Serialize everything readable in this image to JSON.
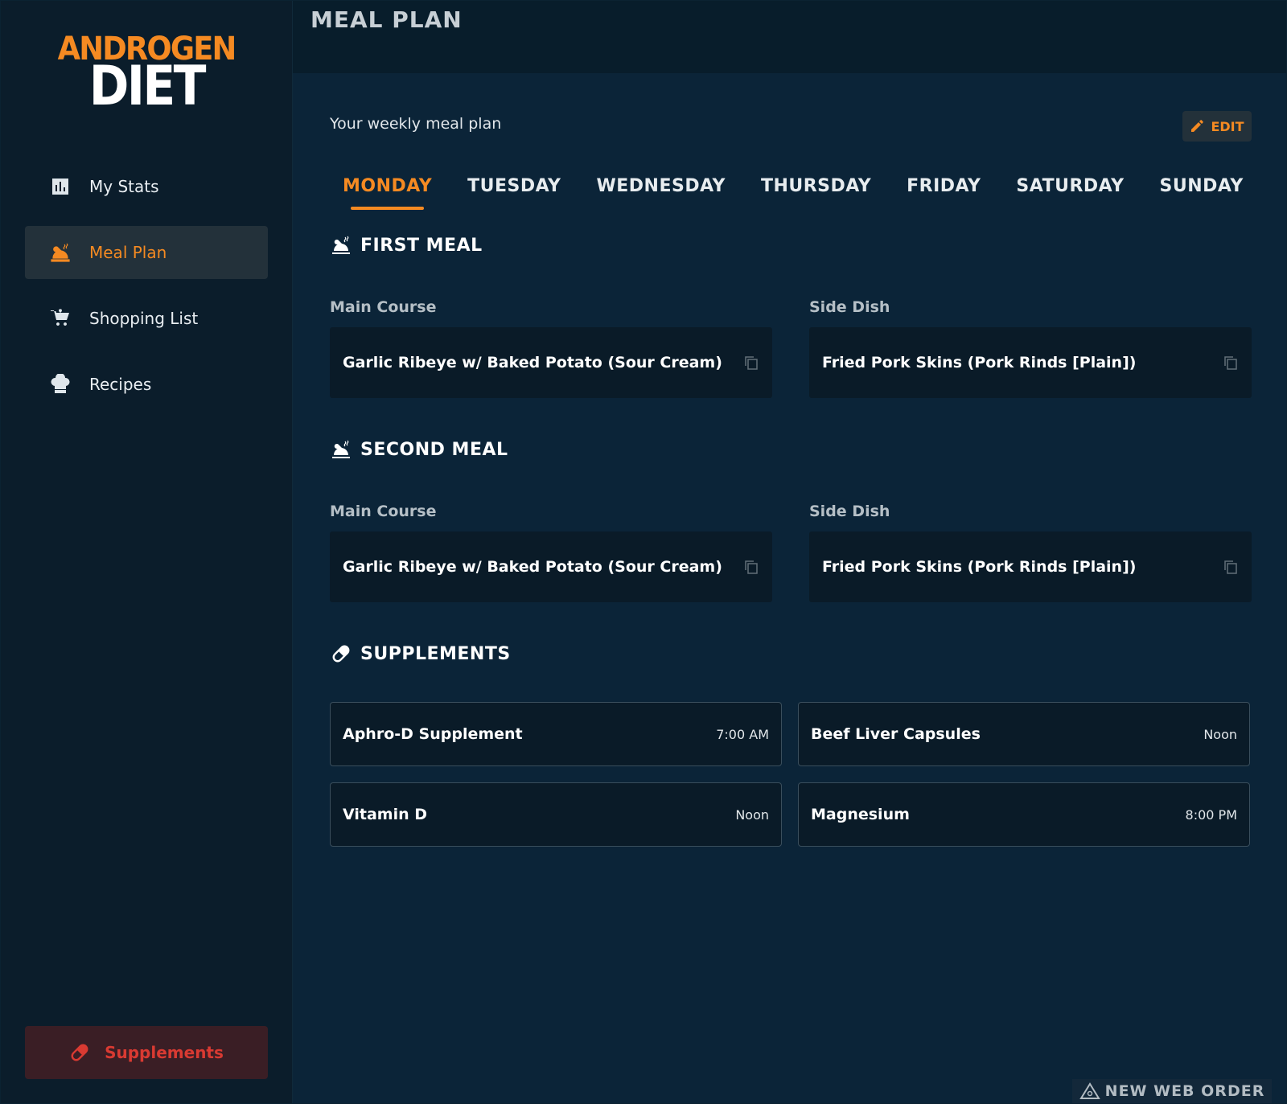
{
  "brand": {
    "line1": "ANDROGEN",
    "line2": "DIET",
    "accent_color": "#f58a22"
  },
  "sidebar": {
    "items": [
      {
        "label": "My Stats",
        "icon": "chart-icon"
      },
      {
        "label": "Meal Plan",
        "icon": "turkey-icon",
        "active": true
      },
      {
        "label": "Shopping List",
        "icon": "cart-icon"
      },
      {
        "label": "Recipes",
        "icon": "chef-hat-icon"
      }
    ],
    "supplements_button": "Supplements"
  },
  "header": {
    "title": "MEAL PLAN"
  },
  "plan": {
    "subtitle": "Your weekly meal plan",
    "edit_label": "EDIT",
    "days": [
      "MONDAY",
      "TUESDAY",
      "WEDNESDAY",
      "THURSDAY",
      "FRIDAY",
      "SATURDAY",
      "SUNDAY"
    ],
    "active_day": "MONDAY"
  },
  "meals": [
    {
      "title": "FIRST MEAL",
      "main_label": "Main Course",
      "main": "Garlic Ribeye w/ Baked Potato (Sour Cream)",
      "side_label": "Side Dish",
      "side": "Fried Pork Skins (Pork Rinds [Plain])"
    },
    {
      "title": "SECOND MEAL",
      "main_label": "Main Course",
      "main": "Garlic Ribeye w/ Baked Potato (Sour Cream)",
      "side_label": "Side Dish",
      "side": "Fried Pork Skins (Pork Rinds [Plain])"
    }
  ],
  "supplements": {
    "title": "SUPPLEMENTS",
    "items": [
      {
        "name": "Aphro-D Supplement",
        "time": "7:00 AM"
      },
      {
        "name": "Beef Liver Capsules",
        "time": "Noon"
      },
      {
        "name": "Vitamin D",
        "time": "Noon"
      },
      {
        "name": "Magnesium",
        "time": "8:00 PM"
      }
    ]
  },
  "watermark": "NEW WEB ORDER"
}
